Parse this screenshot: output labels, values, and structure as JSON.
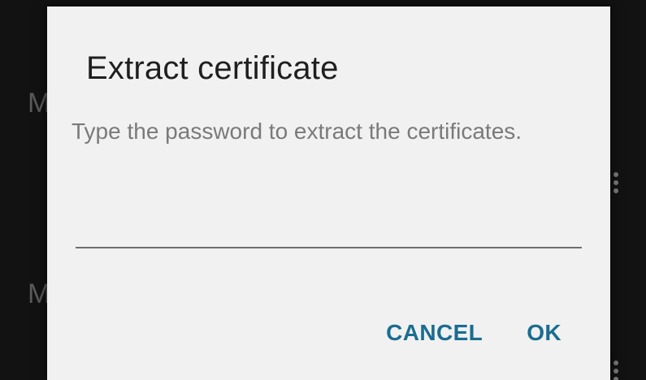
{
  "background": {
    "list_item_letters": [
      "M",
      "M"
    ]
  },
  "dialog": {
    "title": "Extract certificate",
    "message": "Type the password to extract the certificates.",
    "password_value": "",
    "buttons": {
      "cancel_label": "CANCEL",
      "ok_label": "OK"
    }
  },
  "colors": {
    "accent": "#1a6d90",
    "dialog_background": "#f1f1f1",
    "screen_background": "#121213"
  },
  "icons": {
    "overflow_menu": "more-vert-icon"
  }
}
